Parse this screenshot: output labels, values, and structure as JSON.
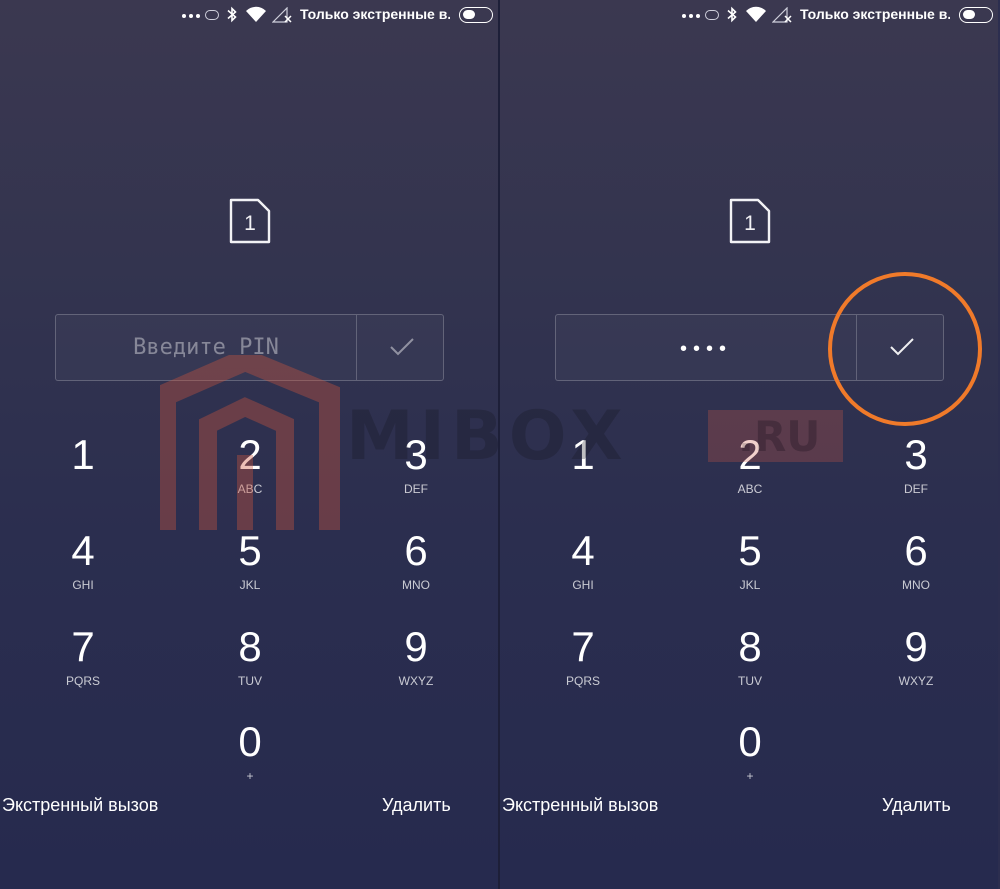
{
  "status_bar": {
    "carrier_text": "Только экстренные в..."
  },
  "left": {
    "pin_placeholder": "Введите PIN",
    "pin_value": ""
  },
  "right": {
    "pin_placeholder": "",
    "pin_value": "••••"
  },
  "keypad": [
    {
      "digit": "1",
      "letters": ""
    },
    {
      "digit": "2",
      "letters": "ABC"
    },
    {
      "digit": "3",
      "letters": "DEF"
    },
    {
      "digit": "4",
      "letters": "GHI"
    },
    {
      "digit": "5",
      "letters": "JKL"
    },
    {
      "digit": "6",
      "letters": "MNO"
    },
    {
      "digit": "7",
      "letters": "PQRS"
    },
    {
      "digit": "8",
      "letters": "TUV"
    },
    {
      "digit": "9",
      "letters": "WXYZ"
    },
    {
      "digit": "0",
      "letters": "+"
    }
  ],
  "actions": {
    "emergency_label": "Экстренный вызов",
    "delete_label": "Удалить"
  },
  "sim_label": "1",
  "watermark": {
    "brand": "MIBOX",
    "tld": ".RU"
  },
  "colors": {
    "highlight": "#f07a2a",
    "background_top": "#3b3850",
    "background_bottom": "#262a4e"
  },
  "icons": [
    "more-dots-icon",
    "ring-icon",
    "bluetooth-icon",
    "wifi-icon",
    "no-signal-icon",
    "toggle-icon",
    "sim-card-icon",
    "checkmark-icon"
  ]
}
